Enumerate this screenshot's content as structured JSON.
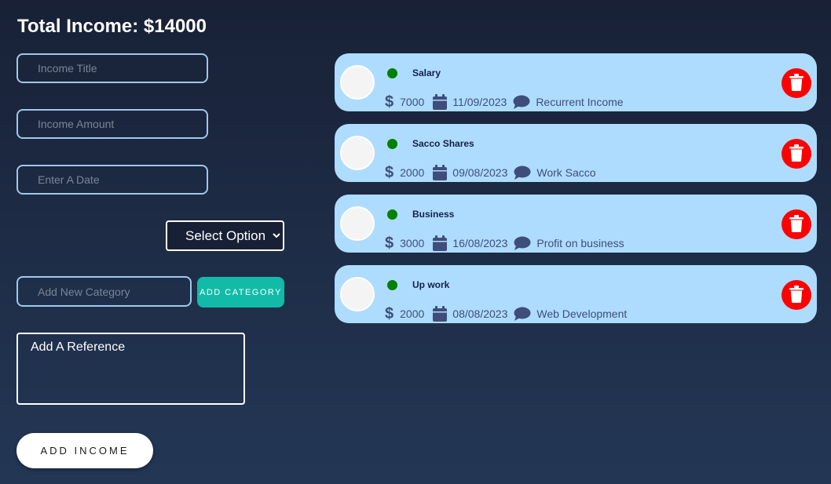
{
  "header": {
    "title": "Total Income: $14000"
  },
  "form": {
    "title_placeholder": "Income Title",
    "amount_placeholder": "Income Amount",
    "date_placeholder": "Enter A Date",
    "select_value": "Select Option",
    "category_placeholder": "Add New Category",
    "add_category_label": "ADD CATEGORY",
    "reference_placeholder": "Add A Reference",
    "add_income_label": "ADD INCOME"
  },
  "incomes": [
    {
      "title": "Salary",
      "amount": "7000",
      "date": "11/09/2023",
      "reference": "Recurrent Income"
    },
    {
      "title": "Sacco Shares",
      "amount": "2000",
      "date": "09/08/2023",
      "reference": "Work Sacco"
    },
    {
      "title": "Business",
      "amount": "3000",
      "date": "16/08/2023",
      "reference": "Profit on business"
    },
    {
      "title": "Up work",
      "amount": "2000",
      "date": "08/08/2023",
      "reference": "Web Development"
    }
  ],
  "icons": {
    "amount": "dollar-icon",
    "date": "calendar-icon",
    "reference": "comment-icon",
    "delete": "trash-icon",
    "status": "status-dot"
  },
  "colors": {
    "card_bg": "#aedcfe",
    "status_green": "#008000",
    "delete_red": "#ff0000",
    "accent_teal": "#11bba7"
  }
}
